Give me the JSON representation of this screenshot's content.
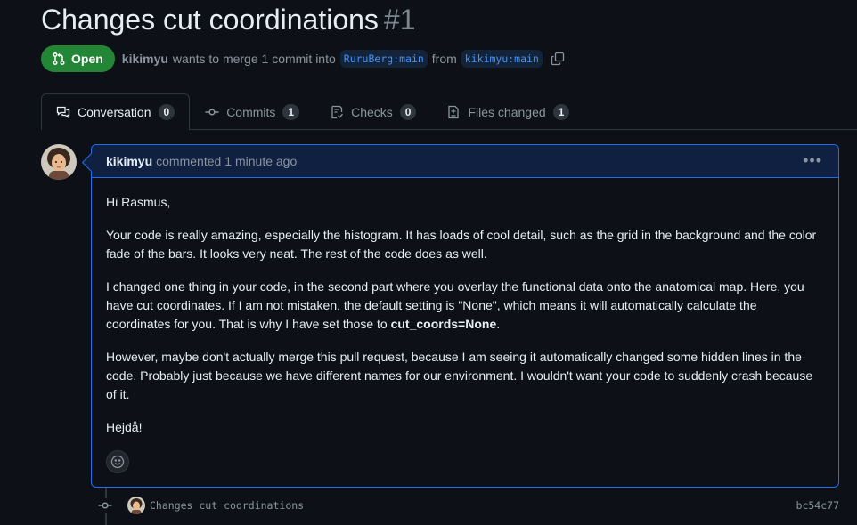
{
  "pr": {
    "title": "Changes cut coordinations",
    "number": "#1",
    "state": "Open",
    "author": "kikimyu",
    "summary_1": "wants to merge 1 commit into",
    "base_branch": "RuruBerg:main",
    "summary_2": "from",
    "head_branch": "kikimyu:main"
  },
  "tabs": [
    {
      "label": "Conversation",
      "count": "0",
      "icon": "comment-discussion-icon"
    },
    {
      "label": "Commits",
      "count": "1",
      "icon": "git-commit-icon"
    },
    {
      "label": "Checks",
      "count": "0",
      "icon": "checklist-icon"
    },
    {
      "label": "Files changed",
      "count": "1",
      "icon": "file-diff-icon"
    }
  ],
  "comment": {
    "author": "kikimyu",
    "action": "commented",
    "time": "1 minute ago",
    "p1": "Hi Rasmus,",
    "p2": "Your code is really amazing, especially the histogram. It has loads of cool detail, such as the grid in the background and the color fade of the bars. It looks very neat. The rest of the code does as well.",
    "p3_a": "I changed one thing in your code, in the second part where you overlay the functional data onto the anatomical map. Here, you have cut coordinates. If I am not mistaken, the default setting is \"None\", which means it will automatically calculate the coordinates for you. That is why I have set those to ",
    "p3_bold": "cut_coords=None",
    "p3_end": ".",
    "p4": "However, maybe don't actually merge this pull request, because I am seeing it automatically changed some hidden lines in the code. Probably just because we have different names for our environment. I wouldn't want your code to suddenly crash because of it.",
    "p5": "Hejdå!"
  },
  "commit": {
    "message": "Changes cut coordinations",
    "sha": "bc54c77"
  },
  "colors": {
    "background": "#0d1117",
    "open_green": "#238636",
    "accent_blue": "#1f6feb",
    "muted": "#8b949e"
  }
}
